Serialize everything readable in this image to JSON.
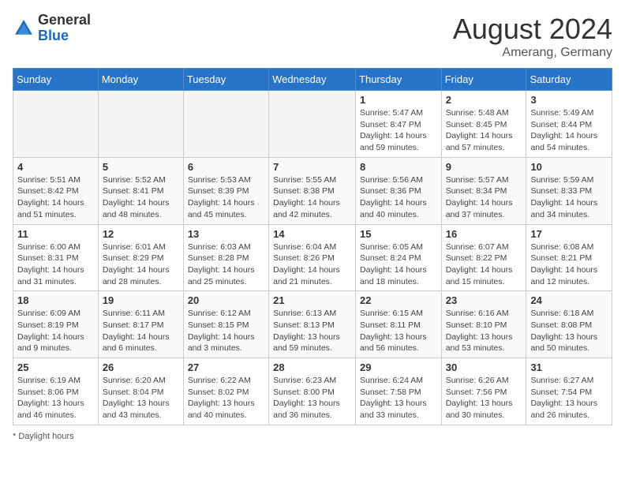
{
  "header": {
    "logo_general": "General",
    "logo_blue": "Blue",
    "month_year": "August 2024",
    "location": "Amerang, Germany"
  },
  "weekdays": [
    "Sunday",
    "Monday",
    "Tuesday",
    "Wednesday",
    "Thursday",
    "Friday",
    "Saturday"
  ],
  "weeks": [
    [
      {
        "day": "",
        "detail": ""
      },
      {
        "day": "",
        "detail": ""
      },
      {
        "day": "",
        "detail": ""
      },
      {
        "day": "",
        "detail": ""
      },
      {
        "day": "1",
        "detail": "Sunrise: 5:47 AM\nSunset: 8:47 PM\nDaylight: 14 hours\nand 59 minutes."
      },
      {
        "day": "2",
        "detail": "Sunrise: 5:48 AM\nSunset: 8:45 PM\nDaylight: 14 hours\nand 57 minutes."
      },
      {
        "day": "3",
        "detail": "Sunrise: 5:49 AM\nSunset: 8:44 PM\nDaylight: 14 hours\nand 54 minutes."
      }
    ],
    [
      {
        "day": "4",
        "detail": "Sunrise: 5:51 AM\nSunset: 8:42 PM\nDaylight: 14 hours\nand 51 minutes."
      },
      {
        "day": "5",
        "detail": "Sunrise: 5:52 AM\nSunset: 8:41 PM\nDaylight: 14 hours\nand 48 minutes."
      },
      {
        "day": "6",
        "detail": "Sunrise: 5:53 AM\nSunset: 8:39 PM\nDaylight: 14 hours\nand 45 minutes."
      },
      {
        "day": "7",
        "detail": "Sunrise: 5:55 AM\nSunset: 8:38 PM\nDaylight: 14 hours\nand 42 minutes."
      },
      {
        "day": "8",
        "detail": "Sunrise: 5:56 AM\nSunset: 8:36 PM\nDaylight: 14 hours\nand 40 minutes."
      },
      {
        "day": "9",
        "detail": "Sunrise: 5:57 AM\nSunset: 8:34 PM\nDaylight: 14 hours\nand 37 minutes."
      },
      {
        "day": "10",
        "detail": "Sunrise: 5:59 AM\nSunset: 8:33 PM\nDaylight: 14 hours\nand 34 minutes."
      }
    ],
    [
      {
        "day": "11",
        "detail": "Sunrise: 6:00 AM\nSunset: 8:31 PM\nDaylight: 14 hours\nand 31 minutes."
      },
      {
        "day": "12",
        "detail": "Sunrise: 6:01 AM\nSunset: 8:29 PM\nDaylight: 14 hours\nand 28 minutes."
      },
      {
        "day": "13",
        "detail": "Sunrise: 6:03 AM\nSunset: 8:28 PM\nDaylight: 14 hours\nand 25 minutes."
      },
      {
        "day": "14",
        "detail": "Sunrise: 6:04 AM\nSunset: 8:26 PM\nDaylight: 14 hours\nand 21 minutes."
      },
      {
        "day": "15",
        "detail": "Sunrise: 6:05 AM\nSunset: 8:24 PM\nDaylight: 14 hours\nand 18 minutes."
      },
      {
        "day": "16",
        "detail": "Sunrise: 6:07 AM\nSunset: 8:22 PM\nDaylight: 14 hours\nand 15 minutes."
      },
      {
        "day": "17",
        "detail": "Sunrise: 6:08 AM\nSunset: 8:21 PM\nDaylight: 14 hours\nand 12 minutes."
      }
    ],
    [
      {
        "day": "18",
        "detail": "Sunrise: 6:09 AM\nSunset: 8:19 PM\nDaylight: 14 hours\nand 9 minutes."
      },
      {
        "day": "19",
        "detail": "Sunrise: 6:11 AM\nSunset: 8:17 PM\nDaylight: 14 hours\nand 6 minutes."
      },
      {
        "day": "20",
        "detail": "Sunrise: 6:12 AM\nSunset: 8:15 PM\nDaylight: 14 hours\nand 3 minutes."
      },
      {
        "day": "21",
        "detail": "Sunrise: 6:13 AM\nSunset: 8:13 PM\nDaylight: 13 hours\nand 59 minutes."
      },
      {
        "day": "22",
        "detail": "Sunrise: 6:15 AM\nSunset: 8:11 PM\nDaylight: 13 hours\nand 56 minutes."
      },
      {
        "day": "23",
        "detail": "Sunrise: 6:16 AM\nSunset: 8:10 PM\nDaylight: 13 hours\nand 53 minutes."
      },
      {
        "day": "24",
        "detail": "Sunrise: 6:18 AM\nSunset: 8:08 PM\nDaylight: 13 hours\nand 50 minutes."
      }
    ],
    [
      {
        "day": "25",
        "detail": "Sunrise: 6:19 AM\nSunset: 8:06 PM\nDaylight: 13 hours\nand 46 minutes."
      },
      {
        "day": "26",
        "detail": "Sunrise: 6:20 AM\nSunset: 8:04 PM\nDaylight: 13 hours\nand 43 minutes."
      },
      {
        "day": "27",
        "detail": "Sunrise: 6:22 AM\nSunset: 8:02 PM\nDaylight: 13 hours\nand 40 minutes."
      },
      {
        "day": "28",
        "detail": "Sunrise: 6:23 AM\nSunset: 8:00 PM\nDaylight: 13 hours\nand 36 minutes."
      },
      {
        "day": "29",
        "detail": "Sunrise: 6:24 AM\nSunset: 7:58 PM\nDaylight: 13 hours\nand 33 minutes."
      },
      {
        "day": "30",
        "detail": "Sunrise: 6:26 AM\nSunset: 7:56 PM\nDaylight: 13 hours\nand 30 minutes."
      },
      {
        "day": "31",
        "detail": "Sunrise: 6:27 AM\nSunset: 7:54 PM\nDaylight: 13 hours\nand 26 minutes."
      }
    ]
  ],
  "footer": {
    "daylight_label": "Daylight hours"
  }
}
